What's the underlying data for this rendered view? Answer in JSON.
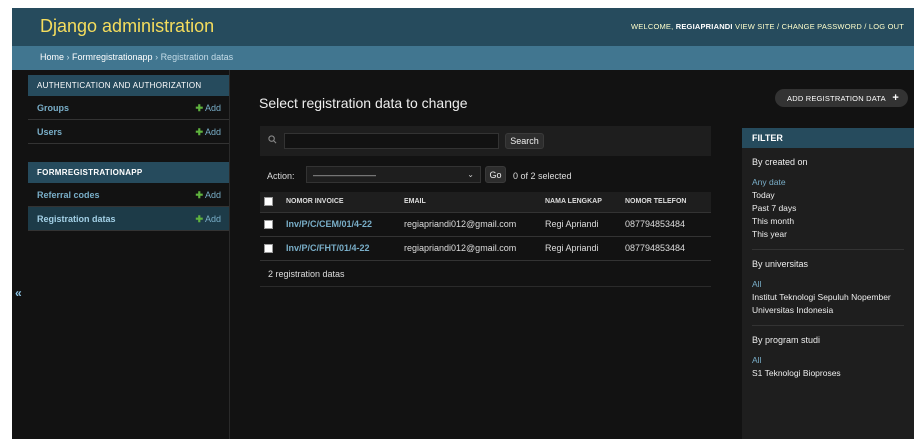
{
  "header": {
    "brand": "Django administration",
    "welcome": "WELCOME,",
    "username": "REGIAPRIANDI",
    "view_site": "VIEW SITE",
    "change_password": "CHANGE PASSWORD",
    "log_out": "LOG OUT",
    "sep": " / "
  },
  "breadcrumbs": {
    "home": "Home",
    "app": "Formregistrationapp",
    "current": "Registration datas",
    "sep": " › "
  },
  "sidebar": {
    "collapse": "«",
    "apps": [
      {
        "caption": "AUTHENTICATION AND AUTHORIZATION",
        "models": [
          {
            "name": "Groups",
            "add": "Add"
          },
          {
            "name": "Users",
            "add": "Add"
          }
        ]
      },
      {
        "caption": "FORMREGISTRATIONAPP",
        "models": [
          {
            "name": "Referral codes",
            "add": "Add"
          },
          {
            "name": "Registration datas",
            "add": "Add"
          }
        ]
      }
    ],
    "plus": "✚"
  },
  "main": {
    "title": "Select registration data to change",
    "add_button": "ADD REGISTRATION DATA",
    "add_icon": "plus-icon",
    "search_button": "Search",
    "search_value": "",
    "action_label": "Action:",
    "action_selected": "———————",
    "go_button": "Go",
    "counter": "0 of 2 selected",
    "columns": [
      "NOMOR INVOICE",
      "EMAIL",
      "NAMA LENGKAP",
      "NOMOR TELEFON"
    ],
    "rows": [
      {
        "invoice": "Inv/P/C/CEM/01/4-22",
        "email": "regiapriandi012@gmail.com",
        "nama": "Regi Apriandi",
        "telefon": "087794853484"
      },
      {
        "invoice": "Inv/P/C/FHT/01/4-22",
        "email": "regiapriandi012@gmail.com",
        "nama": "Regi Apriandi",
        "telefon": "087794853484"
      }
    ],
    "paginator": "2 registration datas"
  },
  "filter": {
    "heading": "FILTER",
    "groups": [
      {
        "title": "By created on",
        "items": [
          "Any date",
          "Today",
          "Past 7 days",
          "This month",
          "This year"
        ],
        "selected": 0
      },
      {
        "title": "By universitas",
        "items": [
          "All",
          "Institut Teknologi Sepuluh Nopember",
          "Universitas Indonesia"
        ],
        "selected": 0
      },
      {
        "title": "By program studi",
        "items": [
          "All",
          "S1 Teknologi Bioproses"
        ],
        "selected": 0
      }
    ]
  },
  "colors": {
    "header_bg": "#264b5d",
    "brand": "#f5dd5d",
    "breadcrumb_bg": "#417690",
    "link": "#79aec8",
    "add_green": "#5fb33e",
    "page_bg": "#121212"
  }
}
